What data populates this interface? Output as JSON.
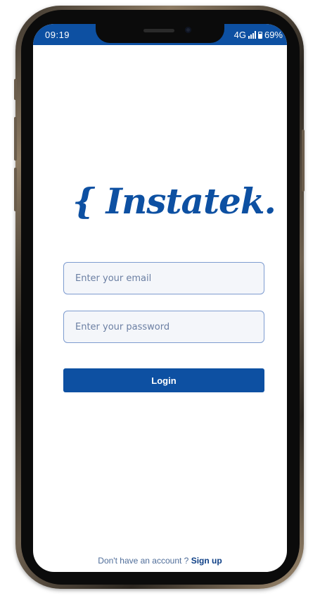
{
  "status_bar": {
    "time": "09:19",
    "network": "4G",
    "battery": "69%"
  },
  "logo": {
    "text": "{ Instatek. }"
  },
  "form": {
    "email_placeholder": "Enter your email",
    "password_placeholder": "Enter your password",
    "login_label": "Login"
  },
  "footer": {
    "prompt": "Don't have an account ? ",
    "signup_label": "Sign up"
  },
  "colors": {
    "brand": "#0d50a2",
    "field_border": "#7e9cd0",
    "field_bg": "#f4f6fa"
  },
  "icons": [
    "signal-icon",
    "battery-icon",
    "front-camera-icon"
  ]
}
